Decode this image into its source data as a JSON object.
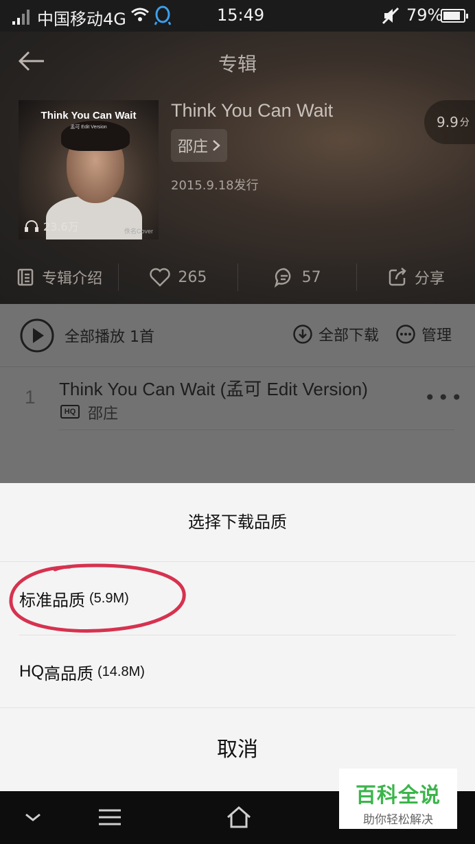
{
  "status_bar": {
    "carrier": "中国移动4G",
    "time": "15:49",
    "battery": "79%"
  },
  "header": {
    "title": "专辑",
    "cover": {
      "title": "Think You Can Wait",
      "subtitle": "孟可 Edit Version",
      "tag": "佚名Cover",
      "plays": "23.6万"
    },
    "album_name": "Think You Can Wait",
    "artist": "邵庄",
    "release": "2015.9.18发行",
    "score_value": "9.9",
    "score_unit": "分",
    "actions": {
      "intro": "专辑介绍",
      "likes": "265",
      "comments": "57",
      "share": "分享"
    }
  },
  "list": {
    "play_all": "全部播放 1首",
    "download_all": "全部下载",
    "manage": "管理",
    "tracks": [
      {
        "index": "1",
        "title": "Think You Can Wait (孟可 Edit Version)",
        "badge": "HQ",
        "artist": "邵庄"
      }
    ]
  },
  "sheet": {
    "title": "选择下载品质",
    "options": [
      {
        "label": "标准品质",
        "size": "(5.9M)"
      },
      {
        "label_hq": "HQ",
        "label": "高品质",
        "size": "(14.8M)"
      }
    ],
    "cancel": "取消"
  },
  "watermark": {
    "main": "百科全说",
    "sub": "助你轻松解决"
  },
  "colors": {
    "annotation": "#d6324f",
    "watermark_green": "#3bb54a"
  }
}
